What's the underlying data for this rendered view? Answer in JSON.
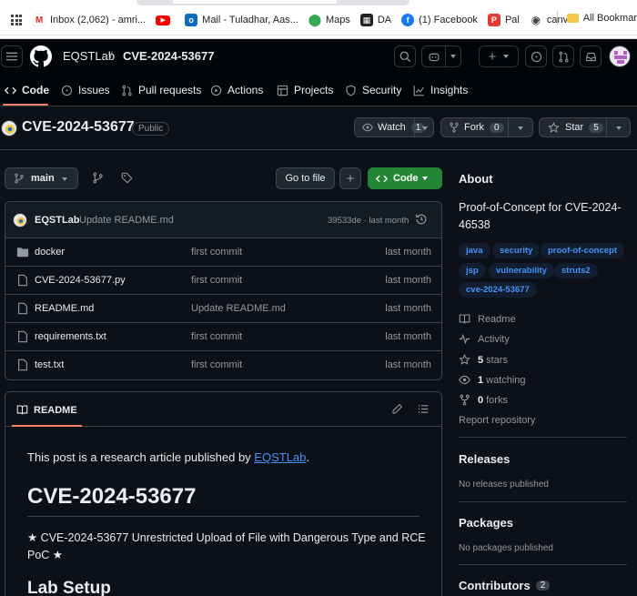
{
  "bookmarks": {
    "items": [
      {
        "label": "Inbox (2,062) - amri...",
        "icon": "gmail-icon",
        "color": "#d93025"
      },
      {
        "label": "",
        "icon": "youtube-icon",
        "color": "#ff0000"
      },
      {
        "label": "Mail - Tuladhar, Aas...",
        "icon": "outlook-icon",
        "color": "#0f6cbd"
      },
      {
        "label": "Maps",
        "icon": "maps-icon",
        "color": "#34a853"
      },
      {
        "label": "DA",
        "icon": "da-icon",
        "color": "#202124"
      },
      {
        "label": "(1) Facebook",
        "icon": "facebook-icon",
        "color": "#1877f2"
      },
      {
        "label": "Pal",
        "icon": "pal-icon",
        "color": "#e53935"
      },
      {
        "label": "canvas",
        "icon": "canvas-icon",
        "color": "#444444"
      }
    ],
    "overflow": "»",
    "all_bookmarks": "All Bookmar"
  },
  "header": {
    "owner": "EQSTLab",
    "separator": "/",
    "repo": "CVE-2024-53677"
  },
  "nav": {
    "code": "Code",
    "issues": "Issues",
    "pull_requests": "Pull requests",
    "actions": "Actions",
    "projects": "Projects",
    "security": "Security",
    "insights": "Insights"
  },
  "repo": {
    "title": "CVE-2024-53677",
    "visibility": "Public",
    "watch_label": "Watch",
    "watch_count": "1",
    "fork_label": "Fork",
    "fork_count": "0",
    "star_label": "Star",
    "star_count": "5"
  },
  "toolbar": {
    "branch": "main",
    "goto_file": "Go to file",
    "code_button": "Code"
  },
  "commit": {
    "author": "EQSTLab",
    "message": "Update README.md",
    "hash_time": "39533de · last month"
  },
  "files": [
    {
      "name": "docker",
      "type": "folder",
      "message": "first commit",
      "time": "last month"
    },
    {
      "name": "CVE-2024-53677.py",
      "type": "file",
      "message": "first commit",
      "time": "last month"
    },
    {
      "name": "README.md",
      "type": "file",
      "message": "Update README.md",
      "time": "last month"
    },
    {
      "name": "requirements.txt",
      "type": "file",
      "message": "first commit",
      "time": "last month"
    },
    {
      "name": "test.txt",
      "type": "file",
      "message": "first commit",
      "time": "last month"
    }
  ],
  "readme": {
    "tab": "README",
    "intro_prefix": "This post is a research article published by ",
    "intro_link": "EQSTLab",
    "intro_suffix": ".",
    "h1": "CVE-2024-53677",
    "tagline_1": "★ CVE-2024-53677 Unrestricted Upload of File with Dangerous Type and RCE",
    "tagline_2": "PoC ★",
    "h2": "Lab Setup"
  },
  "about": {
    "heading": "About",
    "desc_1": "Proof-of-Concept for CVE-2024-",
    "desc_2": "46538",
    "topics": [
      "java",
      "security",
      "proof-of-concept",
      "jsp",
      "vulnerability",
      "struts2",
      "cve-2024-53677"
    ],
    "readme": "Readme",
    "activity": "Activity",
    "stars_num": "5",
    "stars_label": "stars",
    "watching_num": "1",
    "watching_label": "watching",
    "forks_num": "0",
    "forks_label": "forks",
    "report": "Report repository"
  },
  "releases": {
    "heading": "Releases",
    "empty": "No releases published"
  },
  "packages": {
    "heading": "Packages",
    "empty": "No packages published"
  },
  "contributors": {
    "heading": "Contributors",
    "count": "2"
  },
  "colors": {
    "accent": "#f78166",
    "link": "#4493f8",
    "primary_button": "#238636",
    "background": "#0d1117"
  }
}
